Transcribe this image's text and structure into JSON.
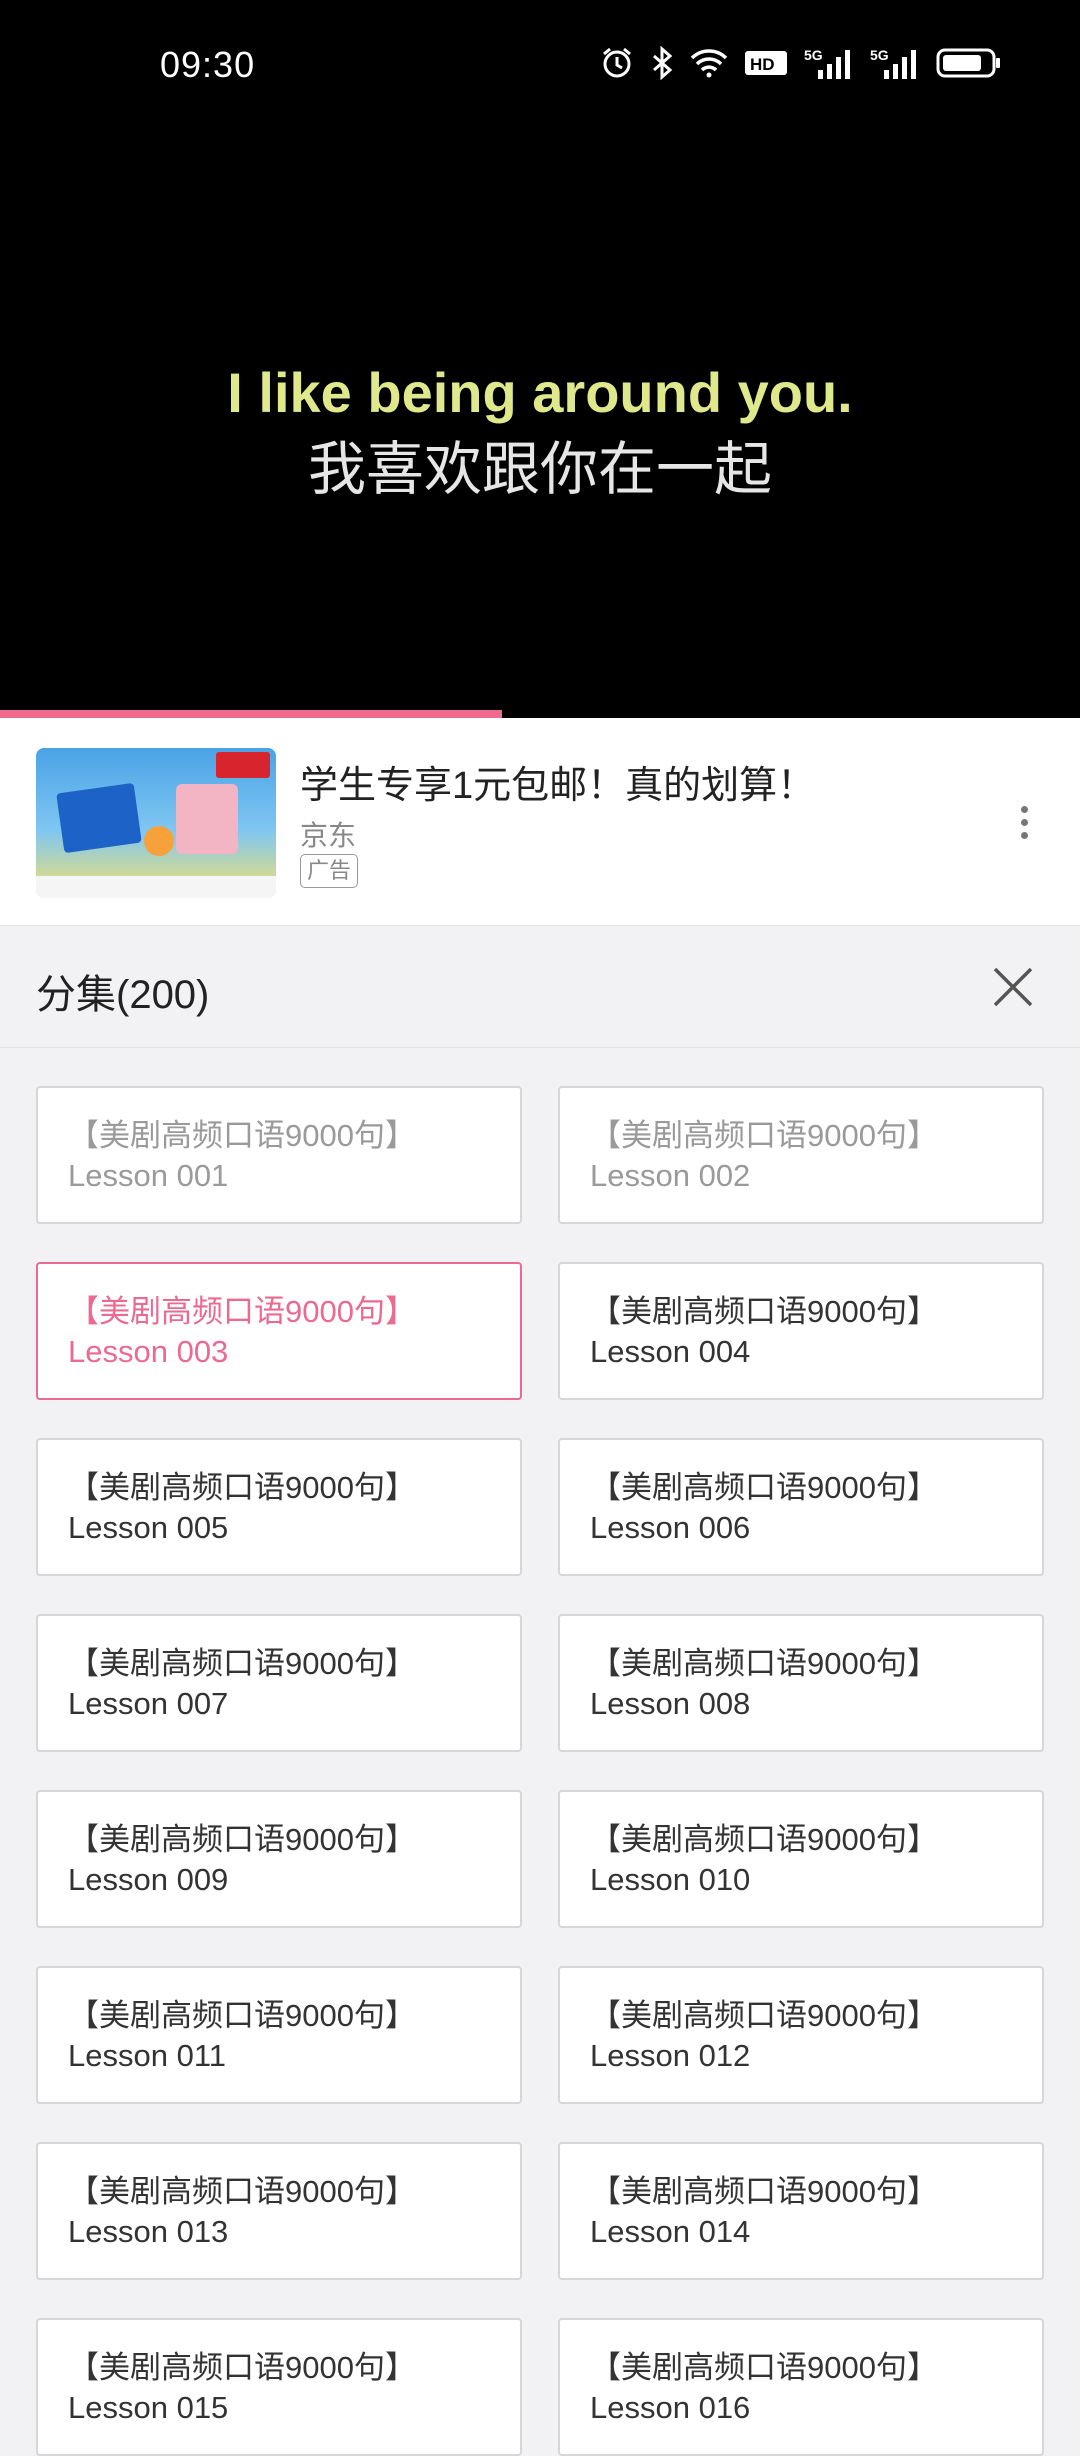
{
  "status_bar": {
    "time": "09:30",
    "icons": [
      "alarm-icon",
      "bluetooth-icon",
      "wifi-icon",
      "hd-icon",
      "5g-signal-icon",
      "5g-signal-icon",
      "battery-icon"
    ],
    "hd_label": "HD",
    "network_label": "5G"
  },
  "video": {
    "subtitle_en": "I like being around you.",
    "subtitle_zh": "我喜欢跟你在一起",
    "progress_fraction": 0.465
  },
  "ad": {
    "title": "学生专享1元包邮！真的划算！",
    "source": "京东",
    "tag": "广告"
  },
  "episodes": {
    "title": "分集(200)",
    "items": [
      {
        "line1": "【美剧高频口语9000句】",
        "line2": "Lesson 001",
        "state": "watched"
      },
      {
        "line1": "【美剧高频口语9000句】",
        "line2": "Lesson 002",
        "state": "watched"
      },
      {
        "line1": "【美剧高频口语9000句】",
        "line2": "Lesson 003",
        "state": "active"
      },
      {
        "line1": "【美剧高频口语9000句】",
        "line2": "Lesson 004",
        "state": "normal"
      },
      {
        "line1": "【美剧高频口语9000句】",
        "line2": "Lesson 005",
        "state": "normal"
      },
      {
        "line1": "【美剧高频口语9000句】",
        "line2": "Lesson 006",
        "state": "normal"
      },
      {
        "line1": "【美剧高频口语9000句】",
        "line2": "Lesson 007",
        "state": "normal"
      },
      {
        "line1": "【美剧高频口语9000句】",
        "line2": "Lesson 008",
        "state": "normal"
      },
      {
        "line1": "【美剧高频口语9000句】",
        "line2": "Lesson 009",
        "state": "normal"
      },
      {
        "line1": "【美剧高频口语9000句】",
        "line2": "Lesson 010",
        "state": "normal"
      },
      {
        "line1": "【美剧高频口语9000句】",
        "line2": "Lesson 011",
        "state": "normal"
      },
      {
        "line1": "【美剧高频口语9000句】",
        "line2": "Lesson 012",
        "state": "normal"
      },
      {
        "line1": "【美剧高频口语9000句】",
        "line2": "Lesson 013",
        "state": "normal"
      },
      {
        "line1": "【美剧高频口语9000句】",
        "line2": "Lesson 014",
        "state": "normal"
      },
      {
        "line1": "【美剧高频口语9000句】",
        "line2": "Lesson 015",
        "state": "normal"
      },
      {
        "line1": "【美剧高频口语9000句】",
        "line2": "Lesson 016",
        "state": "normal"
      }
    ]
  },
  "colors": {
    "accent": "#ec6a92",
    "progress": "#f06a90",
    "subtitle_en": "#dfe88a"
  }
}
